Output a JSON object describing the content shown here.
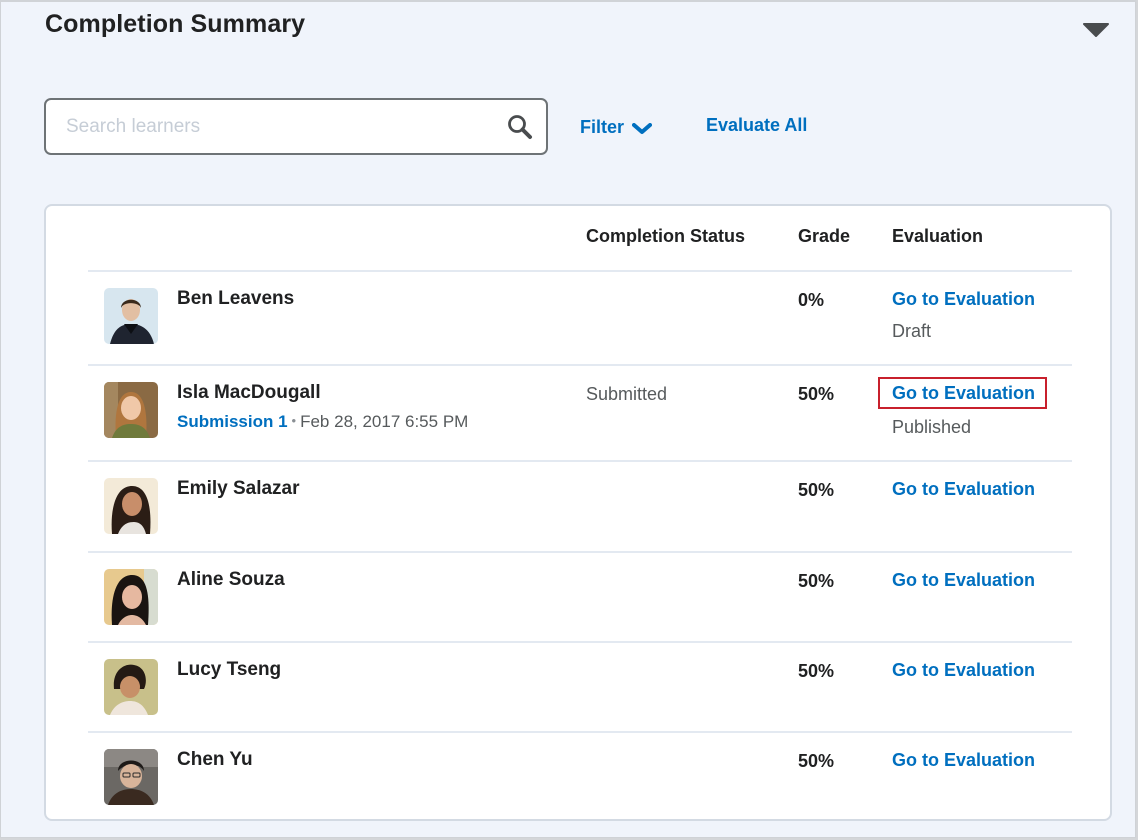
{
  "section": {
    "title": "Completion Summary",
    "collapse_icon": "caret-down-icon"
  },
  "toolbar": {
    "search_placeholder": "Search learners",
    "search_value": "",
    "search_icon": "search-icon",
    "filter_label": "Filter",
    "filter_icon": "chevron-down-icon",
    "evaluate_all_label": "Evaluate All"
  },
  "table": {
    "columns": {
      "learner": "",
      "completion_status": "Completion Status",
      "grade": "Grade",
      "evaluation": "Evaluation"
    },
    "rows": [
      {
        "name": "Ben Leavens",
        "submission_link": "",
        "submission_date": "",
        "completion_status": "",
        "grade": "0%",
        "evaluation_link": "Go to Evaluation",
        "evaluation_state": "Draft",
        "highlighted": false
      },
      {
        "name": "Isla MacDougall",
        "submission_link": "Submission 1",
        "submission_separator": "•",
        "submission_date": "Feb 28, 2017 6:55 PM",
        "completion_status": "Submitted",
        "grade": "50%",
        "evaluation_link": "Go to Evaluation",
        "evaluation_state": "Published",
        "highlighted": true
      },
      {
        "name": "Emily Salazar",
        "completion_status": "",
        "grade": "50%",
        "evaluation_link": "Go to Evaluation",
        "evaluation_state": ""
      },
      {
        "name": "Aline Souza",
        "completion_status": "",
        "grade": "50%",
        "evaluation_link": "Go to Evaluation",
        "evaluation_state": ""
      },
      {
        "name": "Lucy Tseng",
        "completion_status": "",
        "grade": "50%",
        "evaluation_link": "Go to Evaluation",
        "evaluation_state": ""
      },
      {
        "name": "Chen Yu",
        "completion_status": "",
        "grade": "50%",
        "evaluation_link": "Go to Evaluation",
        "evaluation_state": ""
      }
    ]
  },
  "colors": {
    "link": "#006fbf",
    "highlight_border": "#c8202c",
    "panel_background": "#f0f4fb"
  }
}
